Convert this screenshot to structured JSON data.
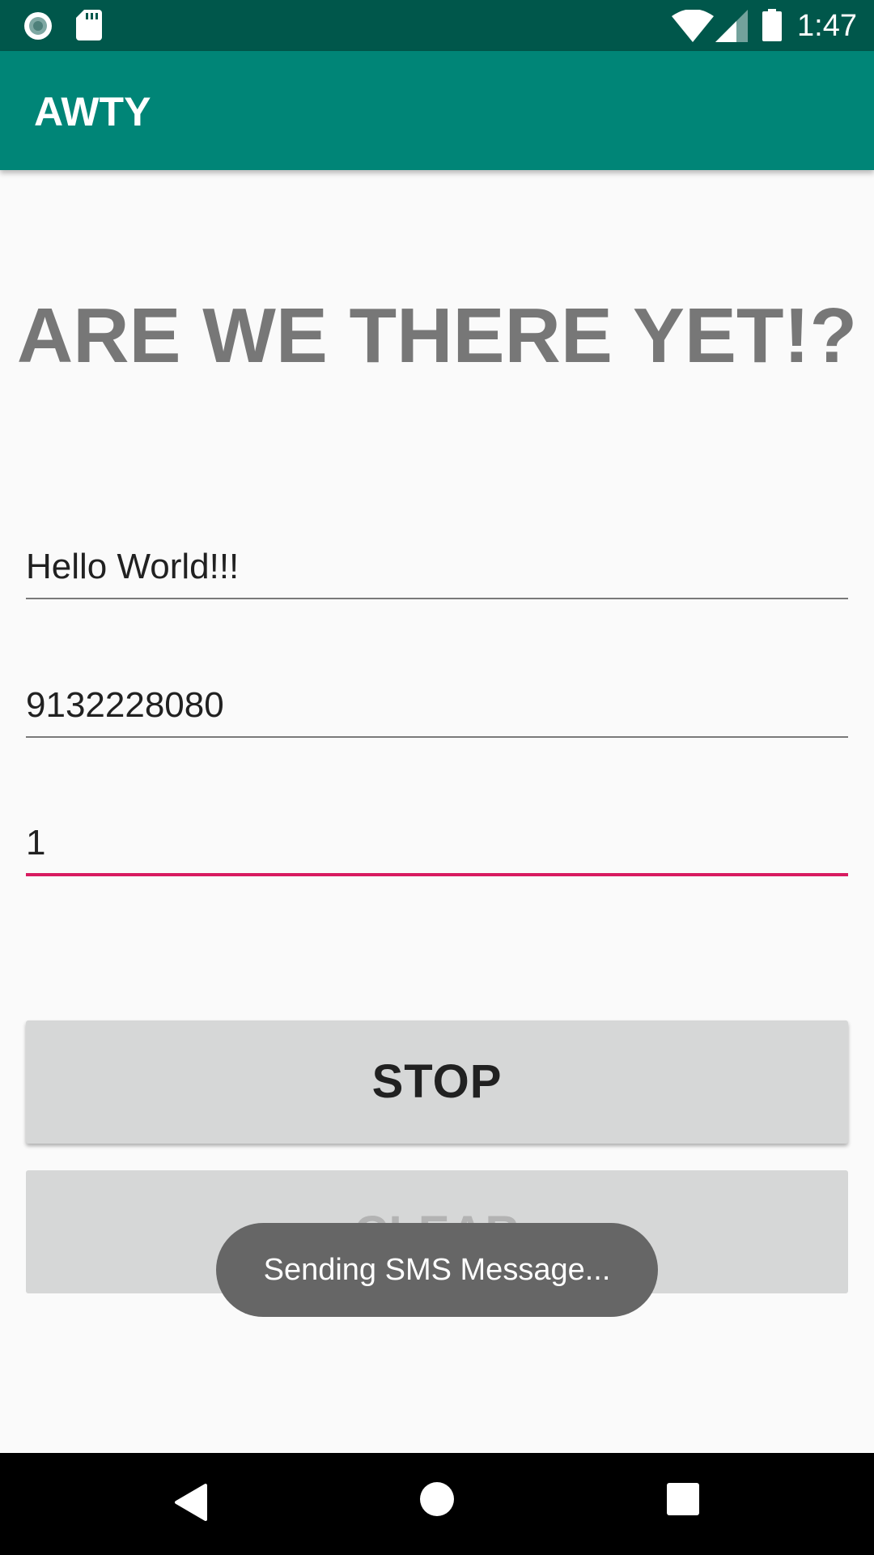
{
  "status_bar": {
    "time": "1:47",
    "icons": [
      "record-icon",
      "sd-card-icon",
      "wifi-icon",
      "cell-signal-icon",
      "battery-icon"
    ]
  },
  "app_bar": {
    "title": "AWTY"
  },
  "main": {
    "heading": "ARE WE THERE YET!?",
    "message_field": {
      "value": "Hello World!!!"
    },
    "phone_field": {
      "value": "9132228080"
    },
    "minutes_field": {
      "value": "1"
    },
    "stop_button": "STOP",
    "clear_button": "CLEAR"
  },
  "toast": {
    "text": "Sending SMS Message..."
  },
  "nav_bar": {
    "icons": [
      "back-icon",
      "home-icon",
      "recents-icon"
    ]
  },
  "colors": {
    "status_bar": "#00574b",
    "app_bar": "#008577",
    "accent": "#d81b60",
    "background": "#fafafa",
    "button": "#d6d7d7",
    "toast": "#666666"
  }
}
